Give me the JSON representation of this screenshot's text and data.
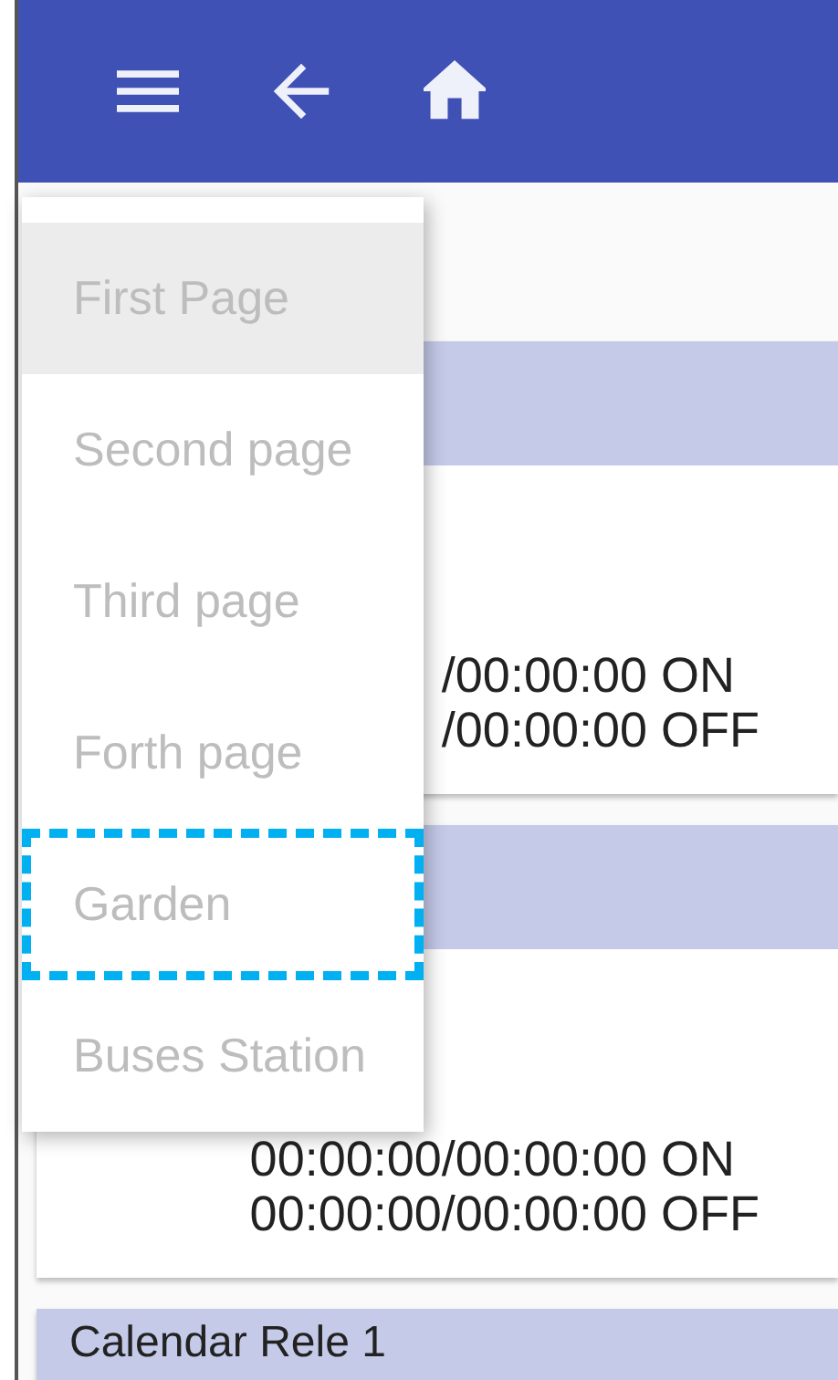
{
  "app_bar": {
    "buttons": [
      {
        "kind": "menu"
      },
      {
        "kind": "back"
      },
      {
        "kind": "home"
      }
    ]
  },
  "menu": {
    "items": [
      {
        "label": "First Page",
        "selected": true,
        "highlighted": false
      },
      {
        "label": "Second page",
        "selected": false,
        "highlighted": false
      },
      {
        "label": "Third page",
        "selected": false,
        "highlighted": false
      },
      {
        "label": "Forth page",
        "selected": false,
        "highlighted": false
      },
      {
        "label": "Garden",
        "selected": false,
        "highlighted": true
      },
      {
        "label": "Buses Station",
        "selected": false,
        "highlighted": false
      }
    ]
  },
  "cards": [
    {
      "lines": [
        "/00:00:00 ON",
        "/00:00:00 OFF"
      ]
    },
    {
      "lines": [
        "00:00:00/00:00:00 ON",
        "00:00:00/00:00:00 OFF"
      ]
    },
    {
      "title": "Calendar Rele 1"
    }
  ]
}
